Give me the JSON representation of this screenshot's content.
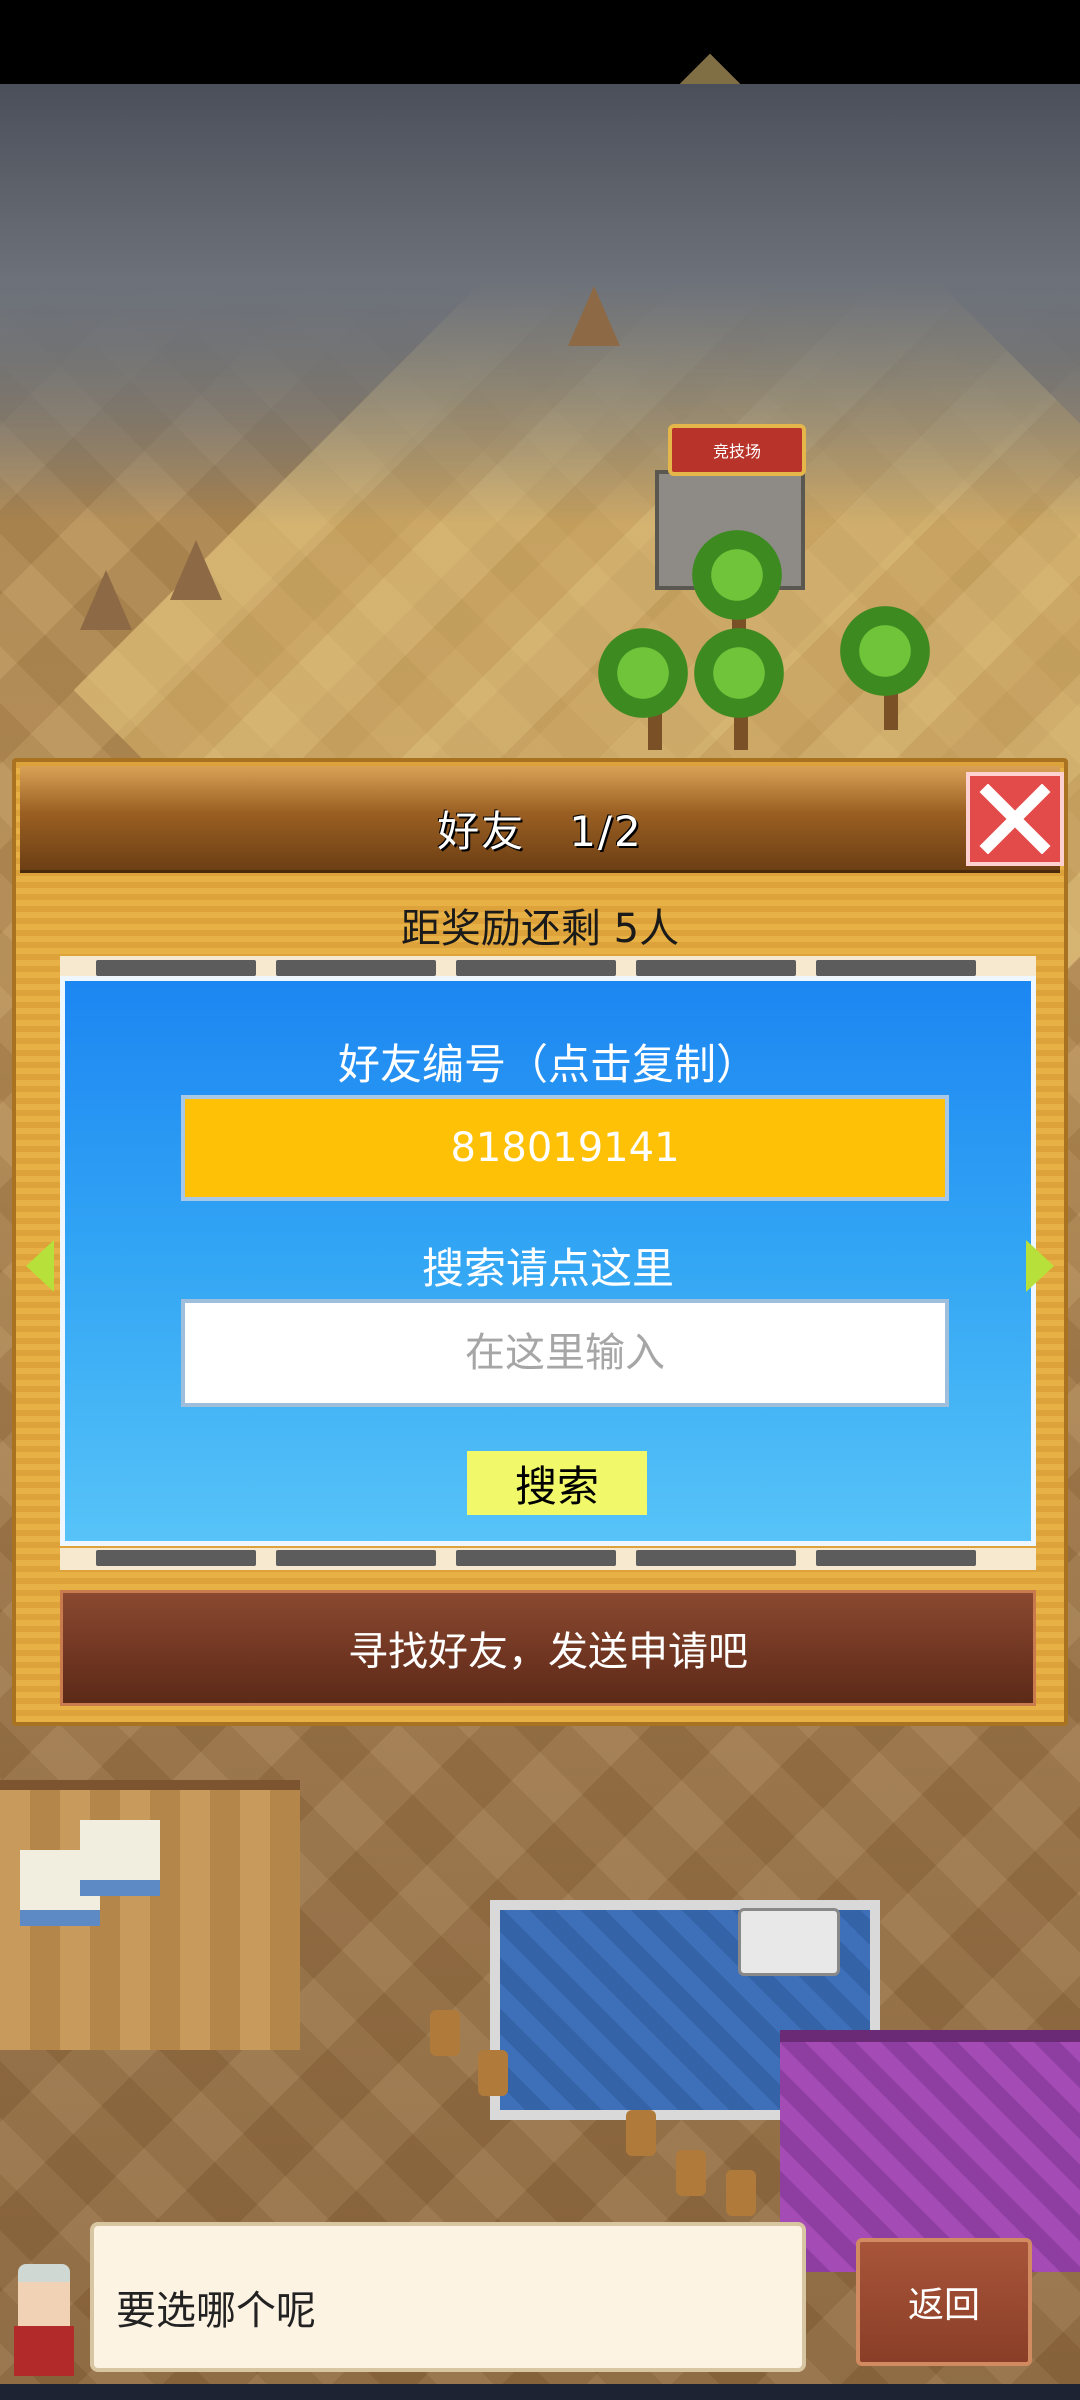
{
  "map": {
    "arena_sign": "竞技场"
  },
  "dialog": {
    "title": "好友　1/2",
    "reward_text": "距奖励还剩 5人",
    "id_label": "好友编号（点击复制）",
    "friend_id": "818019141",
    "search_label": "搜索请点这里",
    "search_placeholder": "在这里输入",
    "search_button": "搜索",
    "find_friends": "寻找好友，发送申请吧"
  },
  "bottom": {
    "npc_message": "要选哪个呢",
    "back_button": "返回"
  },
  "colors": {
    "id_field": "#ffc106",
    "panel_top": "#1c86f2",
    "close": "#e34a4a",
    "search_button": "#f1f86a"
  }
}
